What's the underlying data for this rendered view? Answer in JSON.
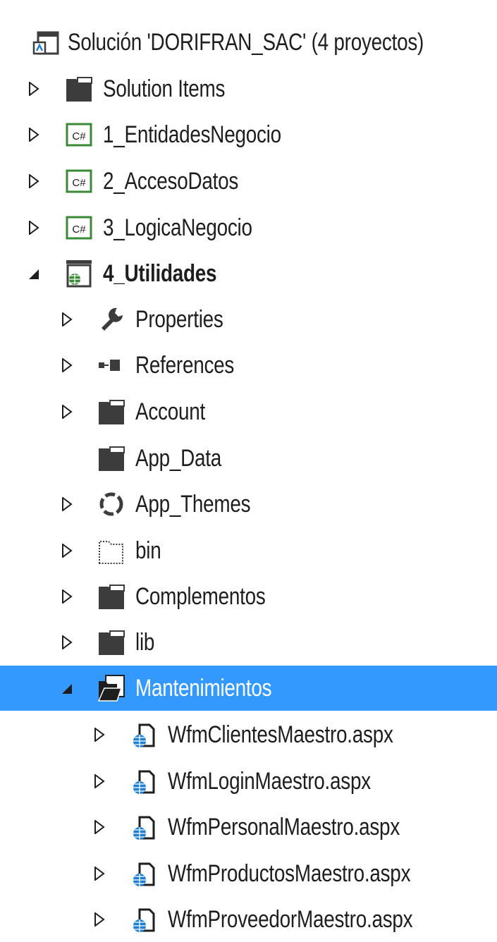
{
  "solution_explorer": {
    "colors": {
      "selection_bg": "#3399ff",
      "csharp_green": "#388a34",
      "web_blue": "#1e7fd4",
      "folder_dark": "#3c3c3c"
    },
    "root": {
      "label": "Solución 'DORIFRAN_SAC'  (4 proyectos)",
      "icon": "solution-icon"
    },
    "items": [
      {
        "label": "Solution Items",
        "icon": "folder-icon",
        "expander": "collapsed"
      },
      {
        "label": "1_EntidadesNegocio",
        "icon": "csharp-project-icon",
        "expander": "collapsed"
      },
      {
        "label": "2_AccesoDatos",
        "icon": "csharp-project-icon",
        "expander": "collapsed"
      },
      {
        "label": "3_LogicaNegocio",
        "icon": "csharp-project-icon",
        "expander": "collapsed"
      },
      {
        "label": "4_Utilidades",
        "icon": "web-project-icon",
        "expander": "expanded",
        "bold": true
      },
      {
        "label": "Properties",
        "icon": "wrench-icon",
        "expander": "collapsed"
      },
      {
        "label": "References",
        "icon": "references-icon",
        "expander": "collapsed"
      },
      {
        "label": "Account",
        "icon": "folder-icon",
        "expander": "collapsed"
      },
      {
        "label": "App_Data",
        "icon": "folder-icon",
        "expander": "none"
      },
      {
        "label": "App_Themes",
        "icon": "themes-icon",
        "expander": "collapsed"
      },
      {
        "label": "bin",
        "icon": "dotted-folder-icon",
        "expander": "collapsed"
      },
      {
        "label": "Complementos",
        "icon": "folder-icon",
        "expander": "collapsed"
      },
      {
        "label": "lib",
        "icon": "folder-icon",
        "expander": "collapsed"
      },
      {
        "label": "Mantenimientos",
        "icon": "open-folder-icon",
        "expander": "expanded",
        "selected": true
      },
      {
        "label": "WfmClientesMaestro.aspx",
        "icon": "aspx-file-icon",
        "expander": "collapsed"
      },
      {
        "label": "WfmLoginMaestro.aspx",
        "icon": "aspx-file-icon",
        "expander": "collapsed"
      },
      {
        "label": "WfmPersonalMaestro.aspx",
        "icon": "aspx-file-icon",
        "expander": "collapsed"
      },
      {
        "label": "WfmProductosMaestro.aspx",
        "icon": "aspx-file-icon",
        "expander": "collapsed"
      },
      {
        "label": "WfmProveedorMaestro.aspx",
        "icon": "aspx-file-icon",
        "expander": "collapsed"
      }
    ]
  }
}
